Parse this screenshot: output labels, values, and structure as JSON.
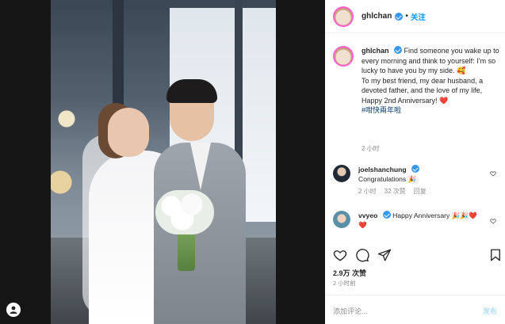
{
  "post": {
    "username": "ghlchan",
    "follow_label": "关注",
    "separator": "•",
    "caption_lines": {
      "text1": "Find someone you wake up to every morning and think to yourself: I’m so lucky to have you by my side. 🥰",
      "text2": "To my best friend, my dear husband, a devoted father, and the love of my life,",
      "text3": "Happy 2nd Anniversary! ❤️",
      "hashtag": "#咁快兩年啦"
    },
    "caption_time": "2 小时",
    "likes": "2.9万 次赞",
    "time": "2 小时前",
    "comment_placeholder": "添加评论...",
    "post_button": "发布"
  },
  "comments": [
    {
      "username": "joelshanchung",
      "text": "Congratulations 🎉",
      "time": "2 小时",
      "likes": "32 次赞",
      "reply": "回复"
    },
    {
      "username": "vvyeo",
      "text": "Happy Anniversary 🎉🎉❤️❤️"
    }
  ],
  "icons": {
    "like": "heart-icon",
    "comment": "comment-icon",
    "share": "share-icon",
    "save": "bookmark-icon",
    "user": "user-icon"
  },
  "colors": {
    "accent": "#0095f6",
    "verified": "#3897f0",
    "muted": "#8e8e8e"
  }
}
